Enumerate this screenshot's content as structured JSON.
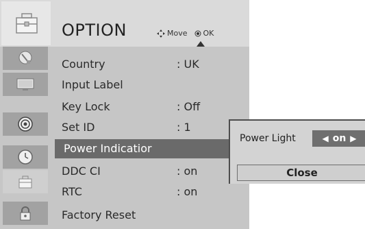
{
  "header": {
    "title": "OPTION",
    "hint_move": "Move",
    "hint_ok": "OK",
    "icon": "option-toolbox-icon"
  },
  "sidebar": {
    "tabs": [
      {
        "icon": "satellite-dish-icon"
      },
      {
        "icon": "tv-screen-icon"
      },
      {
        "icon": "speaker-icon"
      },
      {
        "icon": "clock-icon"
      },
      {
        "icon": "option-toolbox-icon",
        "active": true
      },
      {
        "icon": "padlock-icon"
      }
    ]
  },
  "option_list": {
    "items": [
      {
        "label": "Country",
        "value": ": UK"
      },
      {
        "label": "Input Label",
        "value": ""
      },
      {
        "label": "Key Lock",
        "value": ": Off"
      },
      {
        "label": "Set ID",
        "value": ": 1"
      },
      {
        "label": "Power Indicatior",
        "value": "",
        "selected": true
      },
      {
        "label": "DDC CI",
        "value": ": on"
      },
      {
        "label": "RTC",
        "value": ": on"
      },
      {
        "label": "Factory Reset",
        "value": ""
      }
    ]
  },
  "popup": {
    "label": "Power Light",
    "value": "on",
    "close_label": "Close"
  },
  "colors": {
    "menu_bg": "#c6c6c6",
    "header_bg": "#dadada",
    "selected_row": "#6a6a6a",
    "popup_bg": "#d3d3d3",
    "selector_bg": "#6f6f6f"
  }
}
